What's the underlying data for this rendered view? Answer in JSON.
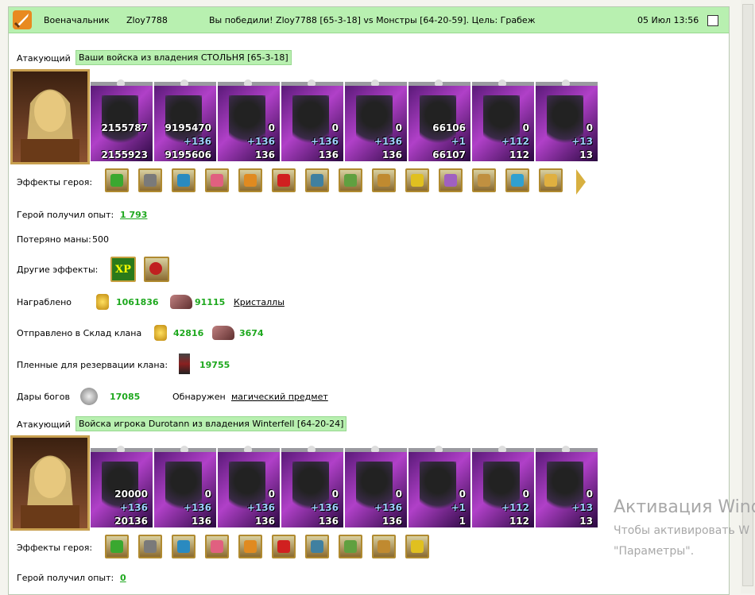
{
  "header": {
    "rank": "Военачальник",
    "player": "Zloy7788",
    "battle_text": "Вы победили! Zloy7788 [65-3-18] vs Монстры [64-20-59]. Цель: Грабеж",
    "datetime": "05 Июл 13:56",
    "icon": "sword-icon"
  },
  "armies": [
    {
      "role": "Атакующий",
      "title": "Ваши войска из владения СТОЛЬНЯ [65-3-18]",
      "units": [
        {
          "top": "2155787",
          "bonus": "",
          "bottom": "2155923"
        },
        {
          "top": "9195470",
          "bonus": "+136",
          "bottom": "9195606"
        },
        {
          "top": "0",
          "bonus": "+136",
          "bottom": "136"
        },
        {
          "top": "0",
          "bonus": "+136",
          "bottom": "136"
        },
        {
          "top": "0",
          "bonus": "+136",
          "bottom": "136"
        },
        {
          "top": "66106",
          "bonus": "+1",
          "bottom": "66107"
        },
        {
          "top": "0",
          "bonus": "+112",
          "bottom": "112"
        },
        {
          "top": "0",
          "bonus": "+13",
          "bottom": "13"
        }
      ],
      "effects_label": "Эффекты героя:",
      "effects": [
        "ring-icon",
        "armor-icon",
        "gem-icon",
        "chest-icon",
        "treasure-icon",
        "heart-icon",
        "shield-icon",
        "crown-icon",
        "amulet-icon",
        "cuirass-icon",
        "spider-icon",
        "bracer-icon",
        "bracelet-icon",
        "gate-icon"
      ],
      "xp_label": "Герой получил опыт:",
      "xp_value": "1 793"
    },
    {
      "role": "Атакующий",
      "title": "Войска игрока Durotann из владения Winterfell [64-20-24]",
      "units": [
        {
          "top": "20000",
          "bonus": "+136",
          "bottom": "20136"
        },
        {
          "top": "0",
          "bonus": "+136",
          "bottom": "136"
        },
        {
          "top": "0",
          "bonus": "+136",
          "bottom": "136"
        },
        {
          "top": "0",
          "bonus": "+136",
          "bottom": "136"
        },
        {
          "top": "0",
          "bonus": "+136",
          "bottom": "136"
        },
        {
          "top": "0",
          "bonus": "+1",
          "bottom": "1"
        },
        {
          "top": "0",
          "bonus": "+112",
          "bottom": "112"
        },
        {
          "top": "0",
          "bonus": "+13",
          "bottom": "13"
        }
      ],
      "effects_label": "Эффекты героя:",
      "effects": [
        "ring-icon",
        "armor-icon",
        "gem-icon",
        "chest-icon",
        "treasure-icon",
        "heart-icon",
        "shield-icon",
        "sword-icon",
        "club-icon",
        "boots-icon"
      ],
      "xp_label": "Герой получил опыт:",
      "xp_value": "0"
    }
  ],
  "mana": {
    "label": "Потеряно маны:",
    "value": "500"
  },
  "other_effects": {
    "label": "Другие эффекты:",
    "xp_badge": "XP"
  },
  "loot": {
    "label": "Награблено",
    "gold": "1061836",
    "crystals": "91115",
    "crystals_link": "Кристаллы"
  },
  "clan_store": {
    "label": "Отправлено в Склад клана",
    "gold": "42816",
    "crystals": "3674"
  },
  "captives": {
    "label": "Пленные для резервации клана:",
    "value": "19755"
  },
  "gifts": {
    "label": "Дары богов",
    "value": "17085",
    "found_label": "Обнаружен",
    "found_link": "магический предмет"
  },
  "watermark": {
    "line1": "Активация Wind",
    "line2": "Чтобы активировать W",
    "line3": "\"Параметры\"."
  }
}
